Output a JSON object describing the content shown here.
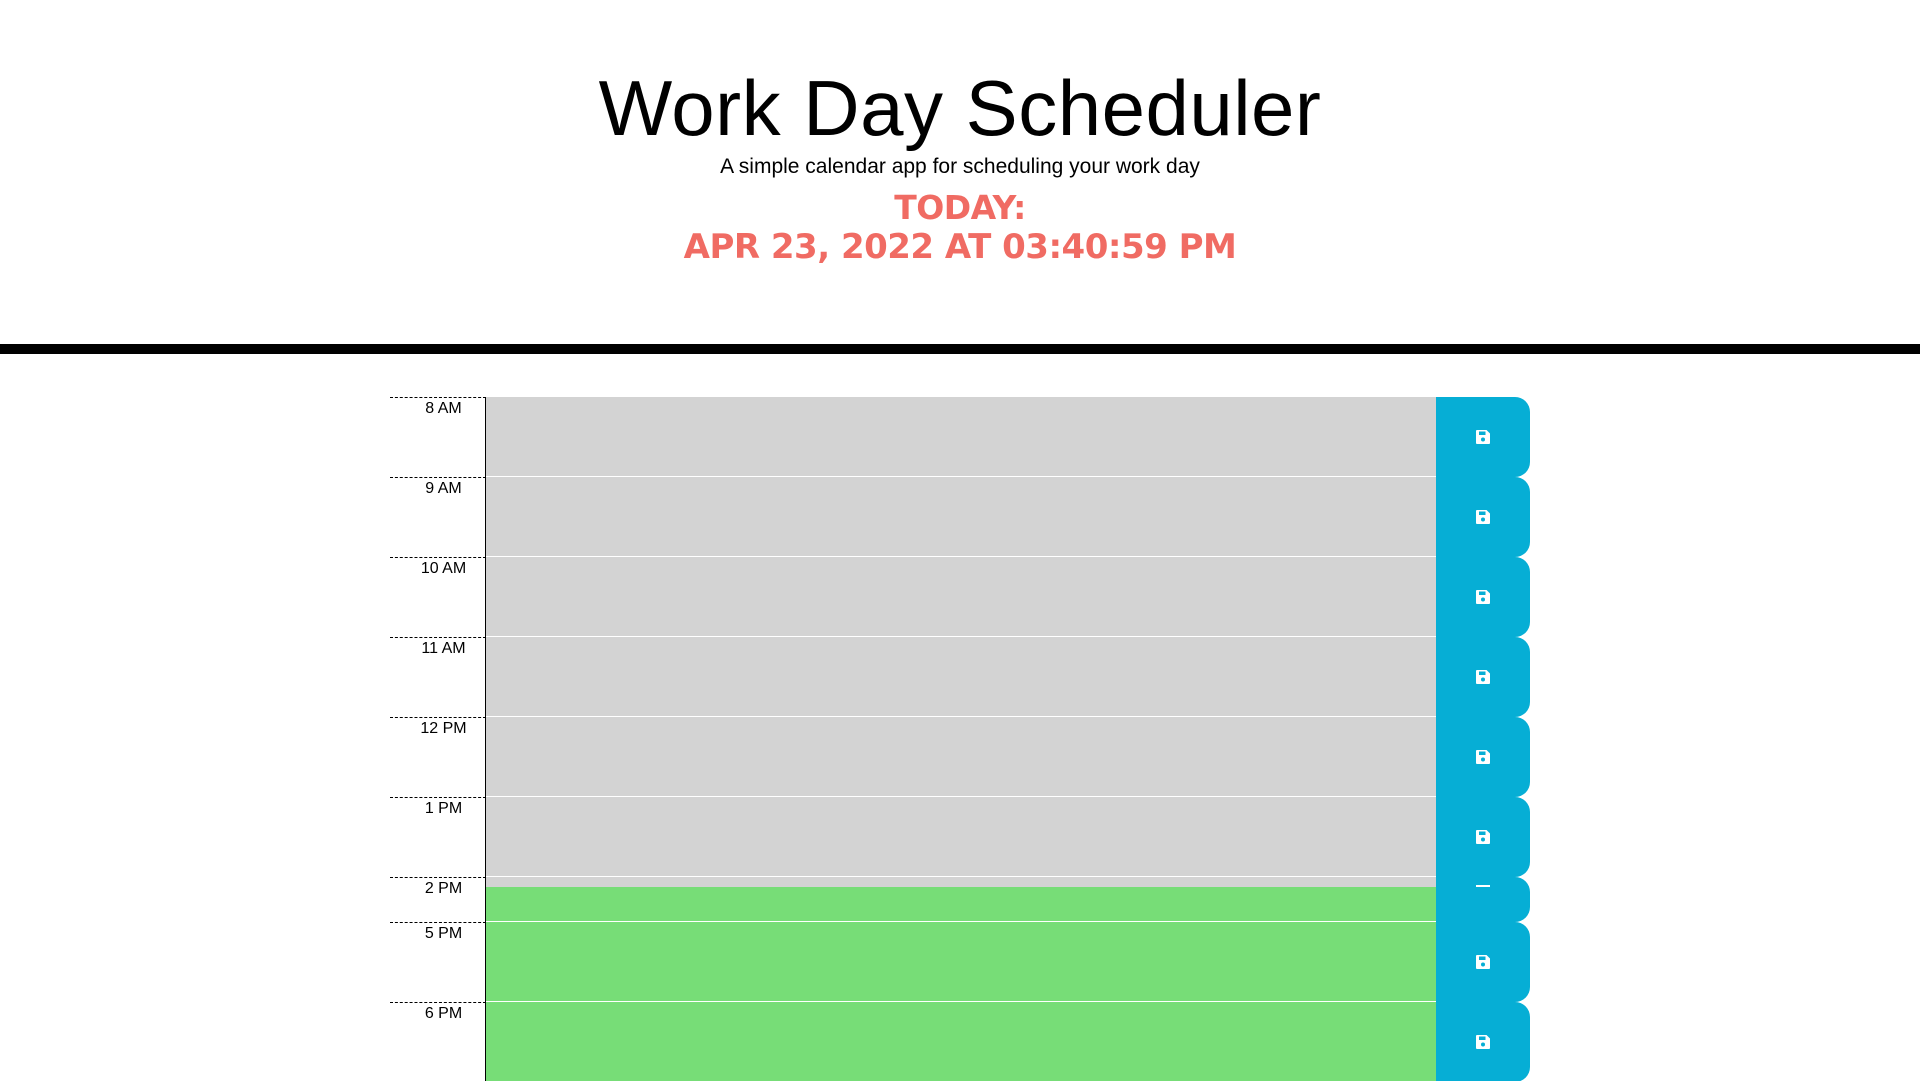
{
  "header": {
    "title": "Work Day Scheduler",
    "subtitle": "A simple calendar app for scheduling your work day",
    "today_label": "Today:",
    "today_date": "Apr 23, 2022 at 03:40:59 pm"
  },
  "colors": {
    "past": "#d3d3d3",
    "present": "#ff6961",
    "future": "#77dd77",
    "save_button": "#06aed5",
    "date_text": "#f06b63"
  },
  "rows": [
    {
      "hour": "8 AM",
      "status": "past",
      "text": "",
      "save_icon": "floppy-disk-icon"
    },
    {
      "hour": "9 AM",
      "status": "past",
      "text": "",
      "save_icon": "floppy-disk-icon"
    },
    {
      "hour": "10 AM",
      "status": "past",
      "text": "",
      "save_icon": "floppy-disk-icon"
    },
    {
      "hour": "11 AM",
      "status": "past",
      "text": "",
      "save_icon": "floppy-disk-icon"
    },
    {
      "hour": "12 PM",
      "status": "past",
      "text": "",
      "save_icon": "floppy-disk-icon"
    },
    {
      "hour": "1 PM",
      "status": "past",
      "text": "",
      "save_icon": "floppy-disk-icon"
    },
    {
      "hour": "2 PM",
      "status": "past",
      "text": "",
      "save_icon": "floppy-disk-icon"
    },
    {
      "hour": "5 PM",
      "status": "future",
      "text": "",
      "save_icon": "floppy-disk-icon"
    },
    {
      "hour": "6 PM",
      "status": "future",
      "text": "",
      "save_icon": "floppy-disk-icon"
    }
  ]
}
